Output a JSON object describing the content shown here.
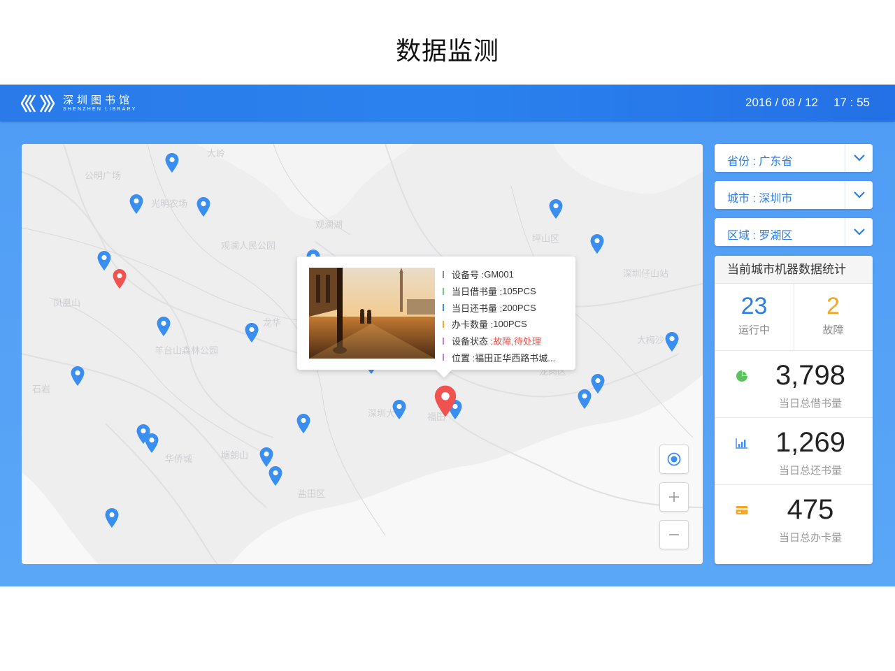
{
  "page": {
    "title": "数据监测"
  },
  "header": {
    "logo_cn": "深圳图书馆",
    "logo_en": "SHENZHEN LIBRARY",
    "date": "2016 / 08 / 12",
    "time": "17 : 55"
  },
  "filters": {
    "province": "省份 : 广东省",
    "city": "城市 : 深圳市",
    "district": "区域 : 罗湖区"
  },
  "popup": {
    "rows": [
      {
        "label": "设备号 : ",
        "value": "GM001",
        "color": "#8a8a8a",
        "danger": false
      },
      {
        "label": "当日借书量 : ",
        "value": "105PCS",
        "color": "#6fcf6f",
        "danger": false
      },
      {
        "label": "当日还书量 : ",
        "value": "200PCS",
        "color": "#3b8ef0",
        "danger": false
      },
      {
        "label": "办卡数量 : ",
        "value": "100PCS",
        "color": "#f5a623",
        "danger": false
      },
      {
        "label": "设备状态 : ",
        "value": "故障,待处理",
        "color": "#c77ee0",
        "danger": true
      },
      {
        "label": "位置 : ",
        "value": "福田正华西路书城...",
        "color": "#c77ee0",
        "danger": false
      }
    ]
  },
  "map_labels": [
    "公明广场",
    "光明农场",
    "观澜湖",
    "观澜人民公园",
    "凤凰山",
    "羊台山森林公园",
    "大岭",
    "深圳大学",
    "塘朗山",
    "深圳湾",
    "平山",
    "坪山区",
    "深圳仔山站",
    "石岩",
    "龙岗区",
    "大梅沙",
    "盐田区",
    "福田",
    "华侨城",
    "龙华"
  ],
  "stats": {
    "title": "当前城市机器数据统计",
    "running_count": "23",
    "running_label": "运行中",
    "fault_count": "2",
    "fault_label": "故障",
    "borrow_total": "3,798",
    "borrow_label": "当日总借书量",
    "return_total": "1,269",
    "return_label": "当日总还书量",
    "card_total": "475",
    "card_label": "当日总办卡量"
  },
  "colors": {
    "accent": "#2b7de9",
    "fault": "#f5a623",
    "pin_blue": "#3a8ef0",
    "pin_red": "#f0524f",
    "borrow_icon": "#5cc35c",
    "return_icon": "#3b8ef0",
    "card_icon": "#f5a623"
  },
  "icons": [
    "logo-mark-icon",
    "chevron-down-icon",
    "locate-icon",
    "zoom-in-icon",
    "zoom-out-icon",
    "map-pin-icon",
    "pie-chart-icon",
    "bar-chart-icon",
    "card-icon"
  ]
}
